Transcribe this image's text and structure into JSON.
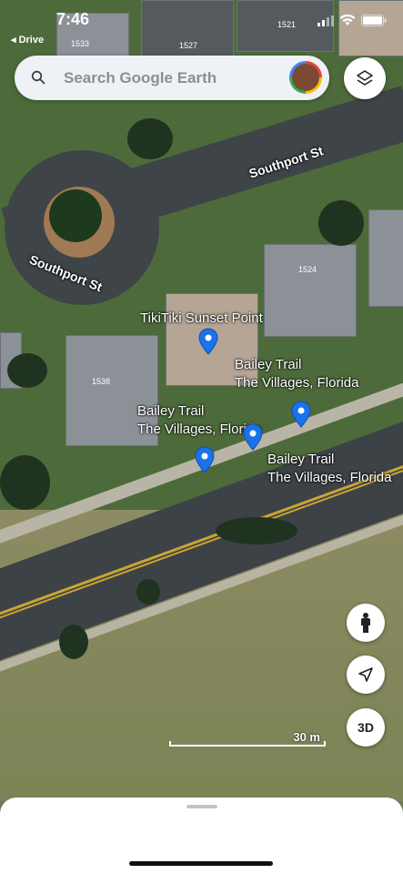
{
  "status_bar": {
    "time": "7:46",
    "back_label": "◂ Drive"
  },
  "search": {
    "placeholder": "Search Google Earth"
  },
  "map": {
    "road_labels": [
      "Southport St",
      "Southport St"
    ],
    "lot_numbers": [
      "1533",
      "1527",
      "1521",
      "1524",
      "1538"
    ],
    "places": [
      {
        "name": "TikiTiki Sunset Point"
      },
      {
        "name": "Bailey Trail",
        "sub": "The Villages, Florida"
      },
      {
        "name": "Bailey Trail",
        "sub": "The Villages, Florida"
      },
      {
        "name": "Bailey Trail",
        "sub": "The Villages, Florida"
      }
    ],
    "scale_label": "30 m"
  },
  "controls": {
    "three_d_label": "3D"
  },
  "colors": {
    "pin": "#1a73e8"
  }
}
